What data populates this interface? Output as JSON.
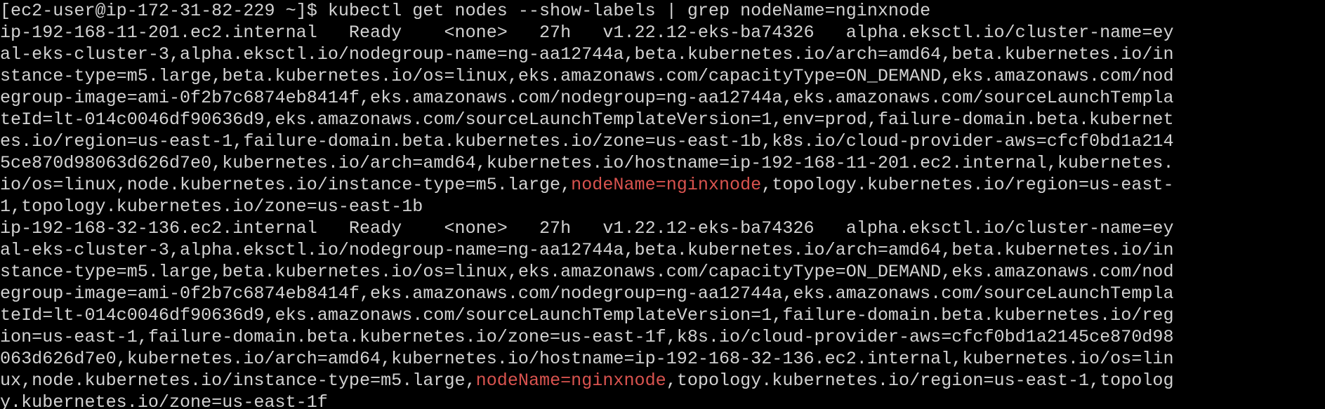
{
  "terminal": {
    "colors": {
      "background": "#000000",
      "text": "#d2d2d2",
      "highlight": "#d9534f"
    },
    "lines": [
      [
        {
          "text": "[ec2-user@ip-172-31-82-229 ~]$ kubectl get nodes --show-labels | grep nodeName=nginxnode"
        }
      ],
      [
        {
          "text": "ip-192-168-11-201.ec2.internal   Ready    <none>   27h   v1.22.12-eks-ba74326   alpha.eksctl.io/cluster-name=ey"
        }
      ],
      [
        {
          "text": "al-eks-cluster-3,alpha.eksctl.io/nodegroup-name=ng-aa12744a,beta.kubernetes.io/arch=amd64,beta.kubernetes.io/in"
        }
      ],
      [
        {
          "text": "stance-type=m5.large,beta.kubernetes.io/os=linux,eks.amazonaws.com/capacityType=ON_DEMAND,eks.amazonaws.com/nod"
        }
      ],
      [
        {
          "text": "egroup-image=ami-0f2b7c6874eb8414f,eks.amazonaws.com/nodegroup=ng-aa12744a,eks.amazonaws.com/sourceLaunchTempla"
        }
      ],
      [
        {
          "text": "teId=lt-014c0046df90636d9,eks.amazonaws.com/sourceLaunchTemplateVersion=1,env=prod,failure-domain.beta.kubernet"
        }
      ],
      [
        {
          "text": "es.io/region=us-east-1,failure-domain.beta.kubernetes.io/zone=us-east-1b,k8s.io/cloud-provider-aws=cfcf0bd1a214"
        }
      ],
      [
        {
          "text": "5ce870d98063d626d7e0,kubernetes.io/arch=amd64,kubernetes.io/hostname=ip-192-168-11-201.ec2.internal,kubernetes."
        }
      ],
      [
        {
          "text": "io/os=linux,node.kubernetes.io/instance-type=m5.large,"
        },
        {
          "text": "nodeName=nginxnode",
          "hl": true
        },
        {
          "text": ",topology.kubernetes.io/region=us-east-"
        }
      ],
      [
        {
          "text": "1,topology.kubernetes.io/zone=us-east-1b"
        }
      ],
      [
        {
          "text": "ip-192-168-32-136.ec2.internal   Ready    <none>   27h   v1.22.12-eks-ba74326   alpha.eksctl.io/cluster-name=ey"
        }
      ],
      [
        {
          "text": "al-eks-cluster-3,alpha.eksctl.io/nodegroup-name=ng-aa12744a,beta.kubernetes.io/arch=amd64,beta.kubernetes.io/in"
        }
      ],
      [
        {
          "text": "stance-type=m5.large,beta.kubernetes.io/os=linux,eks.amazonaws.com/capacityType=ON_DEMAND,eks.amazonaws.com/nod"
        }
      ],
      [
        {
          "text": "egroup-image=ami-0f2b7c6874eb8414f,eks.amazonaws.com/nodegroup=ng-aa12744a,eks.amazonaws.com/sourceLaunchTempla"
        }
      ],
      [
        {
          "text": "teId=lt-014c0046df90636d9,eks.amazonaws.com/sourceLaunchTemplateVersion=1,failure-domain.beta.kubernetes.io/reg"
        }
      ],
      [
        {
          "text": "ion=us-east-1,failure-domain.beta.kubernetes.io/zone=us-east-1f,k8s.io/cloud-provider-aws=cfcf0bd1a2145ce870d98"
        }
      ],
      [
        {
          "text": "063d626d7e0,kubernetes.io/arch=amd64,kubernetes.io/hostname=ip-192-168-32-136.ec2.internal,kubernetes.io/os=lin"
        }
      ],
      [
        {
          "text": "ux,node.kubernetes.io/instance-type=m5.large,"
        },
        {
          "text": "nodeName=nginxnode",
          "hl": true
        },
        {
          "text": ",topology.kubernetes.io/region=us-east-1,topolog"
        }
      ],
      [
        {
          "text": "y.kubernetes.io/zone=us-east-1f"
        }
      ]
    ]
  }
}
